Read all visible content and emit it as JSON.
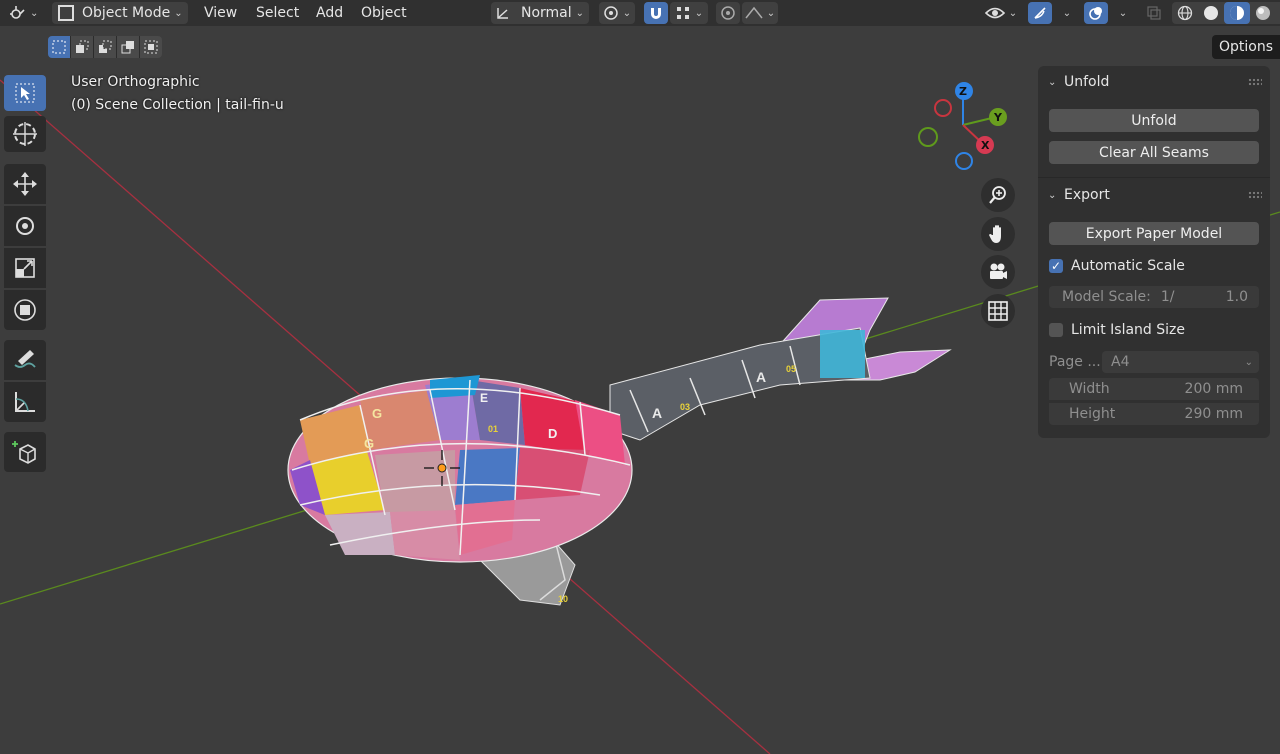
{
  "header": {
    "mode_label": "Object Mode",
    "menus": [
      "View",
      "Select",
      "Add",
      "Object"
    ],
    "orientation_label": "Normal"
  },
  "options_label": "Options",
  "viewport": {
    "view_name": "User Orthographic",
    "collection": "(0) Scene Collection | tail-fin-u",
    "gizmo": {
      "z": "Z",
      "y": "Y",
      "x": "X"
    },
    "uv_labels": [
      "A",
      "A",
      "G",
      "G",
      "E",
      "D",
      "01",
      "03",
      "05",
      "10"
    ]
  },
  "sidebar": {
    "unfold": {
      "title": "Unfold",
      "unfold_button": "Unfold",
      "clear_button": "Clear All Seams"
    },
    "export": {
      "title": "Export",
      "export_button": "Export Paper Model",
      "auto_scale": {
        "label": "Automatic Scale",
        "checked": true
      },
      "model_scale": {
        "label": "Model Scale:",
        "prefix": "1/",
        "value": "1.0"
      },
      "limit_island": {
        "label": "Limit Island Size",
        "checked": false
      },
      "page": {
        "label": "Page ...",
        "value": "A4"
      },
      "width": {
        "label": "Width",
        "value": "200 mm"
      },
      "height": {
        "label": "Height",
        "value": "290 mm"
      }
    }
  },
  "colors": {
    "accent": "#4772b3",
    "x_axis": "#c8353f",
    "y_axis": "#5f9a1c",
    "z_axis": "#2f84e6"
  }
}
